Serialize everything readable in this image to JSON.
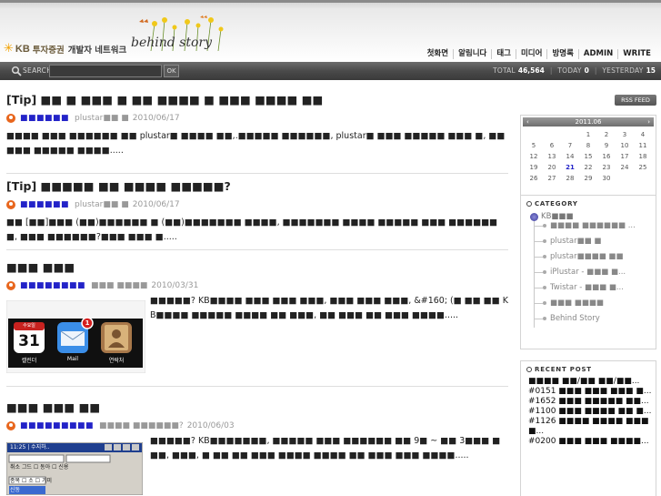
{
  "header": {
    "logo_text": "KB",
    "logo_company": "투자증권",
    "network_name": "개발자 네트워크",
    "brand": "behind story",
    "nav": [
      "첫화면",
      "알림니다",
      "태그",
      "미디어",
      "방명록",
      "ADMIN",
      "WRITE"
    ]
  },
  "searchbar": {
    "search_label": "SEARCH",
    "search_button": "OK",
    "total_label": "TOTAL",
    "total_value": "46,564",
    "today_label": "TODAY",
    "today_value": "0",
    "yesterday_label": "YESTERDAY",
    "yesterday_value": "15"
  },
  "posts": [
    {
      "title": "[Tip] ■■ ■ ■■■ ■ ■■ ■■■■ ■ ■■■ ■■■■ ■■",
      "author": "■■■■■■",
      "author_extra": "plustar■■ ■",
      "date": "2010/06/17",
      "excerpt": "■■■■ ■■■ ■■■■■■ ■■ plustar■ ■■■■ ■■,.■■■■■ ■■■■■■, plustar■ ■■■ ■■■■■ ■■■ ■, ■■■■■ ■■■■■ ■■■■....."
    },
    {
      "title": "[Tip] ■■■■■ ■■ ■■■■ ■■■■■?",
      "author": "■■■■■■",
      "author_extra": "plustar■■ ■",
      "date": "2010/06/17",
      "excerpt": "■■ [■■]■■■ (■■)■■■■■■ ■ (■■)■■■■■■■ ■■■■, ■■■■■■■ ■■■■ ■■■■■ ■■■ ■■■■■■■, ■■■ ■■■■■■?■■■ ■■■ ■....."
    },
    {
      "title": "■■■ ■■■",
      "author": "■■■■■■■■",
      "author_extra": "■■■ ■■■■",
      "date": "2010/03/31",
      "excerpt": "■■■■■? KB■■■■ ■■■ ■■■ ■■■, ■■■ ■■■ ■■■, &#160; (■ ■■ ■■ KB■■■■ ■■■■■ ■■■■ ■■ ■■■, ■■ ■■■ ■■ ■■■ ■■■■....."
    },
    {
      "title": "■■■ ■■■ ■■",
      "author": "■■■■■■■■■",
      "author_extra": "■■■■ ■■■■■■?",
      "date": "2010/06/03",
      "excerpt": "■■■■■? KB■■■■■■■, ■■■■■ ■■■ ■■■■■■ ■■ 9■ ~ ■■ 3■■■ ■■■, ■■■, ■ ■■ ■■ ■■■ ■■■■ ■■■■ ■■ ■■■ ■■■ ■■■■....."
    }
  ],
  "thumb_iphone": {
    "calendar_day": "31",
    "calendar_weekday": "수요일",
    "calendar_label": "캘린더",
    "mail_label": "Mail",
    "contacts_label": "연락처",
    "badge": "1"
  },
  "thumb_window": {
    "title_text": "11:25 | 수지하..",
    "row1": "취소 그드 ☐ 동아 ☐ 신용",
    "row2": "종목 ☐ 소 ☐ 기미",
    "row3": "신동"
  },
  "sidebar": {
    "rss_label": "RSS FEED",
    "calendar": {
      "month": "2011.06",
      "prev": "‹",
      "next": "›",
      "rows": [
        [
          "",
          "",
          "",
          "1",
          "2",
          "3",
          "4"
        ],
        [
          "5",
          "6",
          "7",
          "8",
          "9",
          "10",
          "11"
        ],
        [
          "12",
          "13",
          "14",
          "15",
          "16",
          "17",
          "18"
        ],
        [
          "19",
          "20",
          "21",
          "22",
          "23",
          "24",
          "25"
        ],
        [
          "26",
          "27",
          "28",
          "29",
          "30",
          "",
          ""
        ]
      ],
      "today": "21"
    },
    "category_title": "CATEGORY",
    "category_root": "KB■■■",
    "categories": [
      "■■■■ ■■■■■■ ...",
      "plustar■■ ■",
      "plustar■■■■ ■■",
      "iPlustar - ■■■ ■...",
      "Twistar - ■■■ ■...",
      "■■■ ■■■■",
      "Behind Story"
    ],
    "recent_title": "RECENT POST",
    "recent": [
      "■■■■ ■■/■■ ■■/■■...",
      "#0151 ■■■ ■■■ ■■■ ■...",
      "#1652 ■■■ ■■■■■ ■■...",
      "#1100 ■■■ ■■■■ ■■ ■...",
      "#1126 ■■■■ ■■■■ ■■■■...",
      "#0200 ■■■ ■■■ ■■■■..."
    ]
  }
}
